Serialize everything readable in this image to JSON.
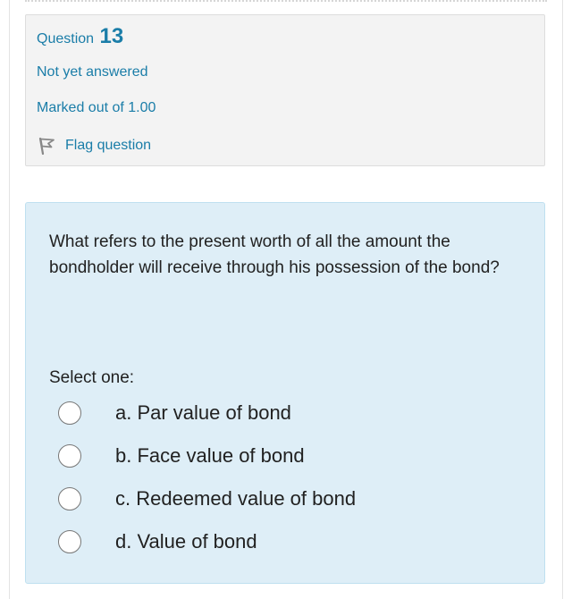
{
  "info": {
    "question_label": "Question",
    "question_number": "13",
    "state": "Not yet answered",
    "grade": "Marked out of 1.00",
    "flag_label": "Flag question",
    "flag_icon": "flag-icon"
  },
  "question": {
    "text": "What refers to the present worth of all the amount the bondholder will receive through his possession of the bond?",
    "prompt": "Select one:",
    "options": [
      {
        "label": "a. Par value of bond",
        "selected": false
      },
      {
        "label": "b. Face value of bond",
        "selected": false
      },
      {
        "label": "c. Redeemed value of bond",
        "selected": false
      },
      {
        "label": "d. Value of bond",
        "selected": false
      }
    ]
  },
  "colors": {
    "link": "#1a7da8",
    "info_bg": "#f3f3f3",
    "content_bg": "#deeef7",
    "text": "#212121"
  }
}
